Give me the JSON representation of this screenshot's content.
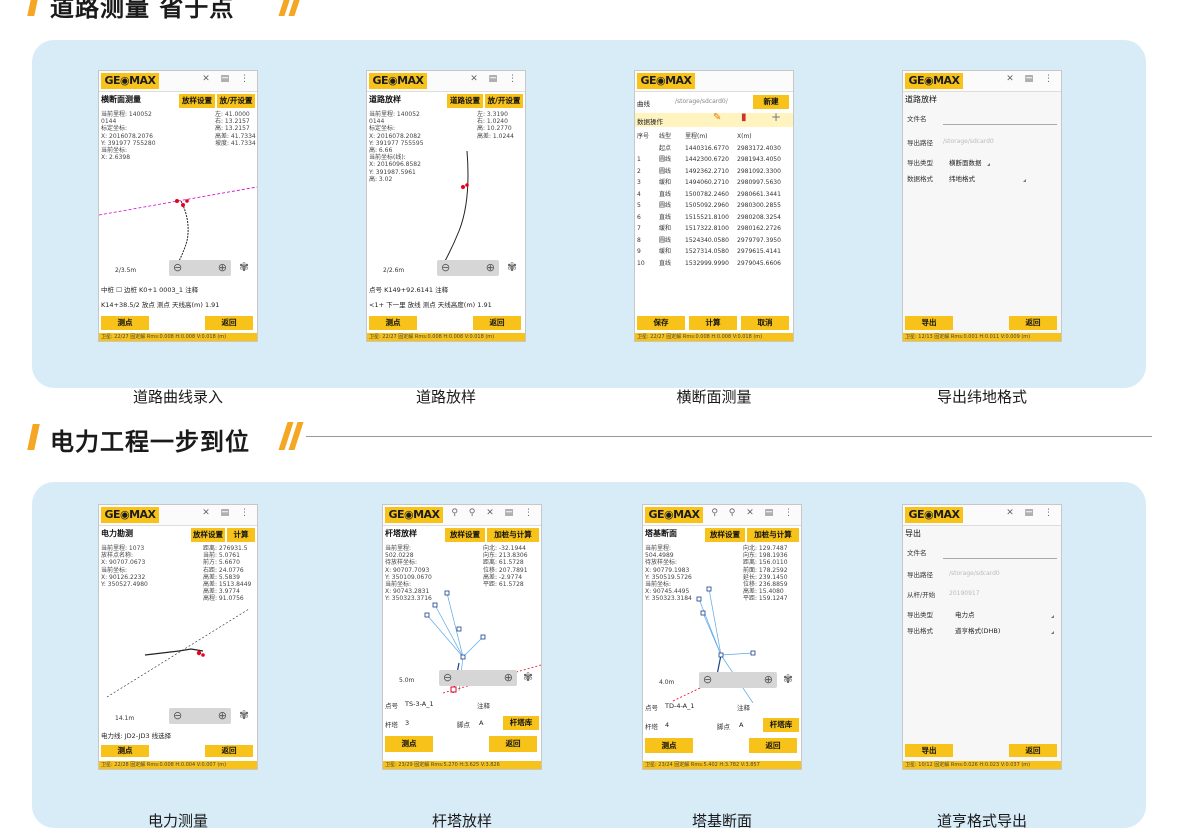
{
  "road_section": {
    "title": "道路测量 省于点",
    "cards": [
      {
        "caption": "道路曲线录入",
        "logo": "GE◉MAX",
        "screen_title": "横断面测量",
        "btn1": "放样设置",
        "btn2": "放/开设置",
        "info_left": "当前里程: 140052\n0144\n标定坐标:\nX: 2016078.2076\nY: 391977 755280\n当前坐标:\nX: 2.6398",
        "info_right": "左: 41.0000\n右: 13.2157\n高: 13.2157\n高差: 41.7334\n坡度: 41.7334",
        "scale": "2/3.5m",
        "row1": "中桩 ☐ 边桩    K0+1 0003_1      注释",
        "row2": "K14+38.5/2   放点   测点   天线高(m)  1.91",
        "bottom_left": "测点",
        "bottom_right": "返回",
        "status": "卫星: 22/27 固定解 Rms:0.008 H:0.008 V:0.018 (m)"
      },
      {
        "caption": "道路放样",
        "logo": "GE◉MAX",
        "screen_title": "道路放样",
        "btn1": "道路设置",
        "btn2": "放/开设置",
        "info_left": "当前里程: 140052\n0144\n标定坐标:\nX: 2016078.2082\nY: 391977 755595\n高: 6.66\n当前坐标(线):\nX: 2016096.8582\nY: 391987.5961\n高: 3.02",
        "info_right": "左: 3.3190\n右: 1.0240\n高: 10.2770\n高差: 1.0244",
        "scale": "2/2.6m",
        "row1": "点号   K149+92.6141          注释",
        "row2": "<1+ 下一里  放线   测点   天线高度(m)  1.91",
        "bottom_left": "测点",
        "bottom_right": "返回",
        "status": "卫星: 22/27 固定解 Rms:0.008 H:0.008 V:0.018 (m)"
      },
      {
        "caption": "横断面测量",
        "logo": "GE◉MAX",
        "screen_title": "曲线",
        "path": "/storage/sdcard0/",
        "path_btn": "新建",
        "ops_label": "数据操作",
        "headers": [
          "序号",
          "线型",
          "里程(m)",
          "X(m)"
        ],
        "rows": [
          [
            "",
            "起点",
            "1440316.6770",
            "2983172.4030"
          ],
          [
            "1",
            "圆线",
            "1442300.6720",
            "2981943.4050"
          ],
          [
            "2",
            "圆线",
            "1492362.2710",
            "2981092.3300"
          ],
          [
            "3",
            "缓和",
            "1494060.2710",
            "2980997.5630"
          ],
          [
            "4",
            "直线",
            "1500782.2460",
            "2980661.3441"
          ],
          [
            "5",
            "圆线",
            "1505092.2960",
            "2980300.2855"
          ],
          [
            "6",
            "直线",
            "1515521.8100",
            "2980208.3254"
          ],
          [
            "7",
            "缓和",
            "1517322.8100",
            "2980162.2726"
          ],
          [
            "8",
            "圆线",
            "1524340.0580",
            "2979797.3950"
          ],
          [
            "9",
            "缓和",
            "1527314.0580",
            "2979615.4141"
          ],
          [
            "10",
            "直线",
            "1532999.9990",
            "2979045.6606"
          ]
        ],
        "bottom_left": "保存",
        "bottom_mid": "计算",
        "bottom_right": "取消",
        "status": "卫星: 22/27 固定解 Rms:0.008 H:0.008 V:0.018 (m)"
      },
      {
        "caption": "导出纬地格式",
        "logo": "GE◉MAX",
        "screen_title": "道路放样",
        "f1_label": "文件名",
        "f2_label": "导出路径",
        "f2_value": "/storage/sdcard0",
        "f3_label": "导出类型",
        "f3_value": "横断面数据",
        "f4_label": "数据格式",
        "f4_value": "纬地格式",
        "bottom_left": "导出",
        "bottom_right": "返回",
        "status": "卫星: 12/13 固定解 Rms:0.001 H:0.011 V:0.009 (m)"
      }
    ]
  },
  "power_section": {
    "title": "电力工程一步到位",
    "cards": [
      {
        "caption": "电力测量",
        "logo": "GE◉MAX",
        "screen_title": "电力勘测",
        "btn1": "放样设置",
        "btn2": "计算",
        "info_left": "当前里程: 1073\n放样点名称:\nX: 90707.0673\n当前坐标:\nX: 90126.2232\nY: 350527.4980",
        "info_right": "距离: 276931.5\n当前: 5.0761\n前方: 5.6670\n右距: 24.0776\n高差: 5.5839\n高差: 1513.8449\n高差: 3.9774\n高程: 91.0756",
        "scale": "14.1m",
        "row1": "电力线:   JD2-JD3                  线选择",
        "bottom_left": "测点",
        "bottom_right": "返回",
        "status": "卫星: 22/28 固定解 Rms:0.008 H:0.004 V:0.007 (m)"
      },
      {
        "caption": "杆塔放样",
        "logo": "GE◉MAX",
        "screen_title": "杆塔放样",
        "btn1": "放样设置",
        "btn2": "加桩与计算",
        "info_left": "当前里程:\n502.0228\n待放样坐标:\nX: 90707.7093\nY: 350109.0670\n当前坐标:\nX: 90743.2831\nY: 350323.3716",
        "info_right": "向北: -32.1944\n向东: 213.8306\n距离: 61.5728\n位移: 207.7891\n高差: -2.9774\n平距: 61.5728",
        "scale": "5.0m",
        "row1_a": "点号",
        "row1_b": "TS-3-A_1",
        "row1_c": "注释",
        "row2_a": "杆塔",
        "row2_b": "3",
        "row2_c": "脚点",
        "row2_d": "A",
        "row2_btn": "杆塔库",
        "bottom_left": "测点",
        "bottom_right": "返回",
        "status": "卫星: 23/29 固定解 Rms:5.270 H:3.625 V:3.826"
      },
      {
        "caption": "塔基断面",
        "logo": "GE◉MAX",
        "screen_title": "塔基断面",
        "btn1": "放样设置",
        "btn2": "加桩与计算",
        "info_left": "当前里程:\n504.4989\n待放样坐标:\nX: 90779.1983\nY: 350519.5726\n当前坐标:\nX: 90745.4495\nY: 350323.3184",
        "info_right": "向北: 129.7487\n向东: 198.1936\n距离: 156.0110\n前面: 178.2592\n延长: 239.1450\n位移: 236.8859\n高差: 15.4080\n平距: 159.1247",
        "scale": "4.0m",
        "row1_a": "点号",
        "row1_b": "TD-4-A_1",
        "row1_c": "注释",
        "row2_a": "杆塔",
        "row2_b": "4",
        "row2_c": "脚点",
        "row2_d": "A",
        "row2_btn": "杆塔库",
        "bottom_left": "测点",
        "bottom_right": "返回",
        "status": "卫星: 23/24 固定解 Rms:5.402 H:3.782 V:3.857"
      },
      {
        "caption": "道亨格式导出",
        "logo": "GE◉MAX",
        "screen_title": "导出",
        "f1_label": "文件名",
        "f2_label": "导出路径",
        "f2_value": "/storage/sdcard0",
        "f3_label": "从杆/开始",
        "f3_value": "20190917",
        "f4_label": "导出类型",
        "f4_value": "电力点",
        "f5_label": "导出格式",
        "f5_value": "道亨格式(DHB)",
        "bottom_left": "导出",
        "bottom_right": "返回",
        "status": "卫星: 10/12 固定解 Rms:0.026 H:0.023 V:0.037 (m)"
      }
    ]
  },
  "colors": {
    "accent": "#f5a623",
    "panel": "#d8ecf8",
    "phone_yellow": "#f7c21a",
    "road_line": "#d100d1",
    "track": "#222222",
    "point": "#e8001f",
    "tower_line": "#1b6ee3"
  }
}
